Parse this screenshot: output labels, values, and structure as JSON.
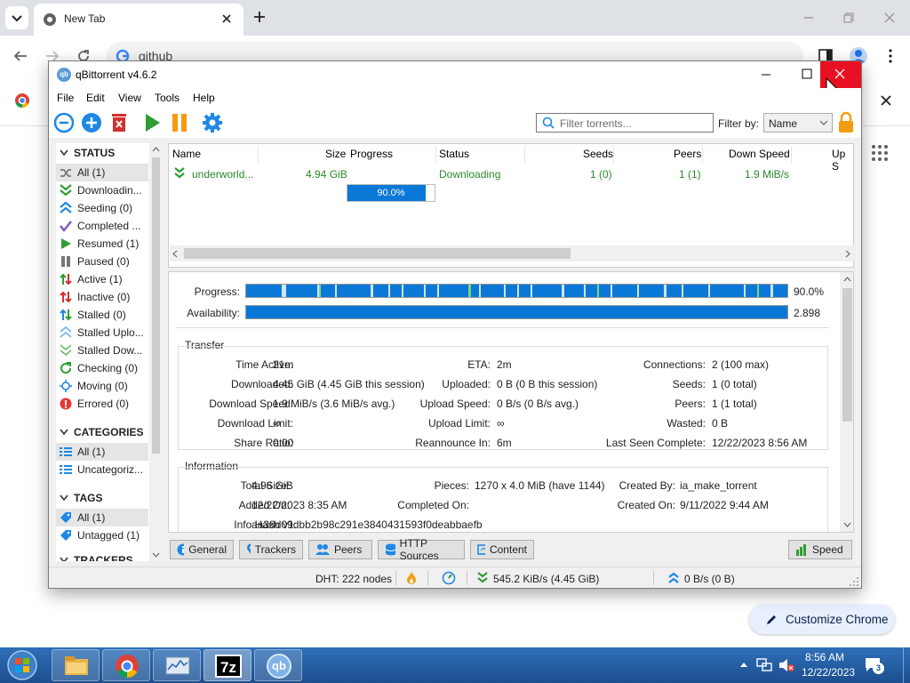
{
  "chrome": {
    "tab_title": "New Tab",
    "omnibox_text": "github",
    "customize_label": "Customize Chrome"
  },
  "qb": {
    "title": "qBittorrent v4.6.2",
    "menu": [
      "File",
      "Edit",
      "View",
      "Tools",
      "Help"
    ],
    "filter_placeholder": "Filter torrents...",
    "filter_by_label": "Filter by:",
    "filter_by_value": "Name",
    "sidebar": {
      "status_header": "STATUS",
      "status_items": [
        {
          "label": "All (1)",
          "icon": "shuffle-icon"
        },
        {
          "label": "Downloadin...",
          "icon": "download-chevron-icon"
        },
        {
          "label": "Seeding (0)",
          "icon": "upload-chevron-icon"
        },
        {
          "label": "Completed ...",
          "icon": "checkmark-icon"
        },
        {
          "label": "Resumed (1)",
          "icon": "play-icon"
        },
        {
          "label": "Paused (0)",
          "icon": "pause-icon"
        },
        {
          "label": "Active (1)",
          "icon": "active-arrows-icon"
        },
        {
          "label": "Inactive (0)",
          "icon": "inactive-arrows-icon"
        },
        {
          "label": "Stalled (0)",
          "icon": "stalled-arrows-icon"
        },
        {
          "label": "Stalled Uplo...",
          "icon": "stalled-upload-icon"
        },
        {
          "label": "Stalled Dow...",
          "icon": "stalled-download-icon"
        },
        {
          "label": "Checking (0)",
          "icon": "refresh-icon"
        },
        {
          "label": "Moving (0)",
          "icon": "move-icon"
        },
        {
          "label": "Errored (0)",
          "icon": "error-icon"
        }
      ],
      "categories_header": "CATEGORIES",
      "category_items": [
        "All (1)",
        "Uncategoriz..."
      ],
      "tags_header": "TAGS",
      "tag_items": [
        "All (1)",
        "Untagged (1)"
      ],
      "trackers_header": "TRACKERS"
    },
    "list": {
      "columns": [
        "Name",
        "Size",
        "Progress",
        "Status",
        "Seeds",
        "Peers",
        "Down Speed",
        "Up S"
      ],
      "row": {
        "name": "underworld...",
        "size": "4.94 GiB",
        "progress": 0.9,
        "progress_text": "90.0%",
        "status": "Downloading",
        "seeds": "1 (0)",
        "peers": "1 (1)",
        "down_speed": "1.9 MiB/s"
      }
    },
    "details": {
      "progress_label": "Progress:",
      "progress_value": "90.0%",
      "availability_label": "Availability:",
      "availability_value": "2.898",
      "transfer_header": "Transfer",
      "transfer": {
        "time_active_label": "Time Active:",
        "time_active": "21m",
        "eta_label": "ETA:",
        "eta": "2m",
        "connections_label": "Connections:",
        "connections": "2 (100 max)",
        "downloaded_label": "Downloaded:",
        "downloaded": "4.45 GiB (4.45 GiB this session)",
        "uploaded_label": "Uploaded:",
        "uploaded": "0 B (0 B this session)",
        "seeds_label": "Seeds:",
        "seeds": "1 (0 total)",
        "dl_speed_label": "Download Speed:",
        "dl_speed": "1.9 MiB/s (3.6 MiB/s avg.)",
        "ul_speed_label": "Upload Speed:",
        "ul_speed": "0 B/s (0 B/s avg.)",
        "peers_label": "Peers:",
        "peers": "1 (1 total)",
        "dl_limit_label": "Download Limit:",
        "dl_limit": "∞",
        "ul_limit_label": "Upload Limit:",
        "ul_limit": "∞",
        "wasted_label": "Wasted:",
        "wasted": "0 B",
        "share_ratio_label": "Share Ratio:",
        "share_ratio": "0.00",
        "reannounce_label": "Reannounce In:",
        "reannounce": "6m",
        "last_seen_label": "Last Seen Complete:",
        "last_seen": "12/22/2023 8:56 AM"
      },
      "info_header": "Information",
      "info": {
        "total_size_label": "Total Size:",
        "total_size": "4.96 GiB",
        "pieces_label": "Pieces:",
        "pieces": "1270 x 4.0 MiB (have 1144)",
        "created_by_label": "Created By:",
        "created_by": "ia_make_torrent",
        "added_on_label": "Added On:",
        "added_on": "12/22/2023 8:35 AM",
        "completed_on_label": "Completed On:",
        "completed_on": "",
        "created_on_label": "Created On:",
        "created_on": "9/11/2022 9:44 AM",
        "hash_label": "Info Hash v1:",
        "hash": "aa38d09dbb2b98c291e3840431593f0deabbaefb"
      }
    },
    "tabs": [
      "General",
      "Trackers",
      "Peers",
      "HTTP Sources",
      "Content"
    ],
    "speed_tab": "Speed",
    "statusbar": {
      "dht": "DHT: 222 nodes",
      "download": "545.2 KiB/s (4.45 GiB)",
      "upload": "0 B/s (0 B)"
    }
  },
  "taskbar": {
    "time": "8:56 AM",
    "date": "12/22/2023",
    "notification_count": "3",
    "apps": [
      "file-explorer-icon",
      "chrome-icon",
      "system-monitor-icon",
      "7zip-icon",
      "qbittorrent-icon"
    ],
    "sevenzip_label": "7z",
    "qb_label": "qb"
  },
  "colors": {
    "accent_blue": "#0a78d7",
    "status_green": "#2a8a2a",
    "close_red": "#e81123",
    "taskbar": "#1f5597"
  }
}
